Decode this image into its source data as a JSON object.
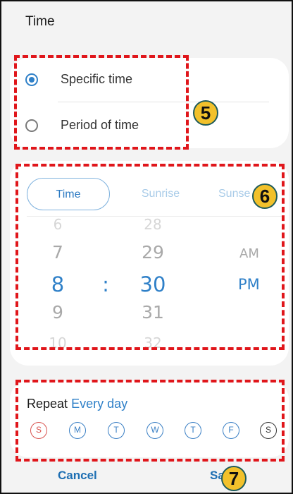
{
  "header": {
    "title": "Time"
  },
  "time_type": {
    "options": [
      {
        "label": "Specific time",
        "selected": true
      },
      {
        "label": "Period of time",
        "selected": false
      }
    ]
  },
  "picker": {
    "tabs": [
      {
        "label": "Time"
      },
      {
        "label": "Sunrise"
      },
      {
        "label": "Sunse"
      }
    ],
    "hours": [
      "6",
      "7",
      "8",
      "9",
      "10"
    ],
    "minutes": [
      "28",
      "29",
      "30",
      "31",
      "32"
    ],
    "separator": ":",
    "ampm": [
      "AM",
      "PM"
    ]
  },
  "repeat": {
    "label": "Repeat",
    "value": "Every day",
    "days": [
      "S",
      "M",
      "T",
      "W",
      "T",
      "F",
      "S"
    ]
  },
  "buttons": {
    "cancel": "Cancel",
    "save": "Sa"
  },
  "annotations": [
    "5",
    "6",
    "7"
  ],
  "colors": {
    "accent": "#2f80c8",
    "highlight": "#e0161b",
    "badge": "#f2c12b"
  }
}
